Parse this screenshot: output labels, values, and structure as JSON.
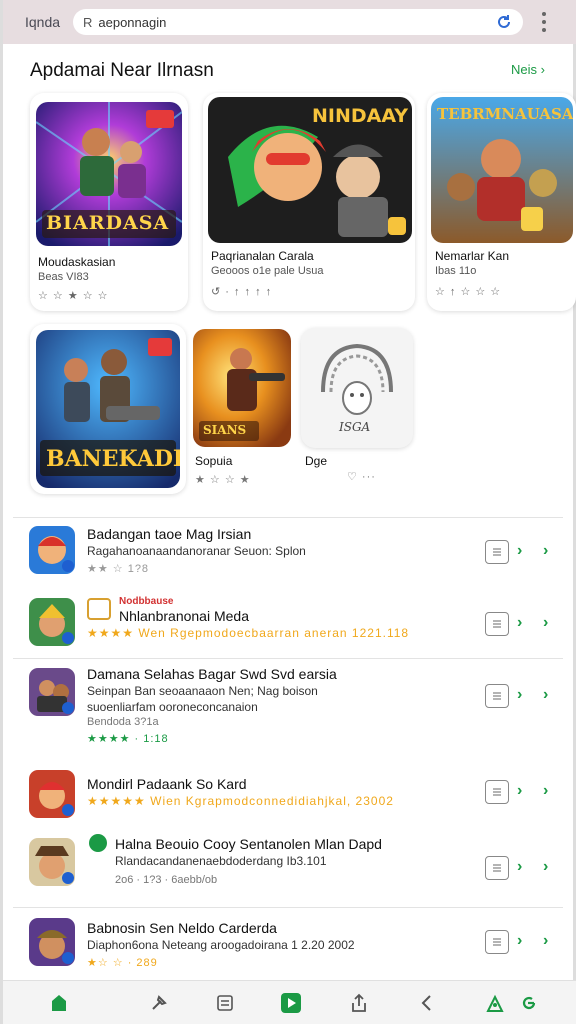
{
  "topbar": {
    "brand": "Iqnda",
    "search_value": "aeponnagin"
  },
  "section": {
    "title": "Apdamai Near Ilrnasn",
    "more_label": "Neis ›"
  },
  "featured": [
    {
      "art_text": "BIARDASA",
      "title": "Moudaskasian",
      "sub": "Beas VI83",
      "meta": "☆ ☆ ★ ☆ ☆"
    },
    {
      "art_text": "NINDAAY",
      "title": "Paqrianalan Carala",
      "sub": "Geooos o1e pale Usua",
      "meta": "↺ · ↑ ↑ ↑ ↑"
    },
    {
      "art_text": "TEBRMNAUASA",
      "title": "Nemarlar Kan",
      "sub": "Ibas 11o",
      "meta": "☆ ↑ ☆ ☆ ☆"
    },
    {
      "art_text": "BANEKADIS",
      "title": "",
      "sub": "",
      "meta": ""
    },
    {
      "art_text": "SIANS",
      "title": "Sopuia",
      "sub": "",
      "meta": "★ ☆ ☆ ★"
    },
    {
      "art_text": "ISGA",
      "title": "Dge",
      "sub": "",
      "meta": "♡ ···"
    }
  ],
  "list": [
    {
      "title": "Badangan taoe Mag Irsian",
      "tag": "",
      "line1": "Ragahanoanaandanoranar Seuon: Splon",
      "line2": "",
      "meta": "★★ ☆ 1?8",
      "stars": "grey"
    },
    {
      "title": "Nhlanbranonai Meda",
      "tag": "Nodbbause",
      "line1": "★★★★ Wen Rgepmodoecbaarran aneran 1221.118",
      "line2": "",
      "meta": "",
      "stars": "gold"
    },
    {
      "title": "Damana Selahas Bagar Swd Svd earsia",
      "tag": "",
      "line1": "Seinpan Ban seoaanaaon Nen; Nag boison",
      "line2": "suoenliarfam ooroneconcanaion",
      "meta": "Bendoda 3?1a",
      "meta2": "★★★★ · 1:18",
      "stars": "green"
    },
    {
      "title": "Mondirl Padaank So Kard",
      "tag": "",
      "line1": "★★★★★ Wien Kgrapmodconnedidiahjkal, 23002",
      "line2": "",
      "meta": "",
      "stars": "gold"
    },
    {
      "title": "Halna Beouio Cooy Sentanolen Mlan Dapd",
      "tag": "",
      "line1": "Rlandacandanenaebdoderdang Ib3.101",
      "line2": "",
      "meta": "2o6 · 1?3 · 6aebb/ob",
      "stars": "grey"
    },
    {
      "title": "Babnosin Sen Neldo Carderda",
      "tag": "",
      "line1": "Diaphon6ona Neteang aroogadoirana 1 2.20 2002",
      "line2": "",
      "meta": "★☆ ☆ · 289",
      "stars": "gold"
    }
  ],
  "colors": {
    "accent": "#1b9a45",
    "topbar": "#e7dde0",
    "red_tag": "#d23131",
    "star": "#f0a81c"
  },
  "bottom_nav": [
    "home-icon",
    "hammer-icon",
    "doc-icon",
    "play-icon",
    "share-icon",
    "back-icon",
    "person-icon",
    "refresh-icon"
  ]
}
